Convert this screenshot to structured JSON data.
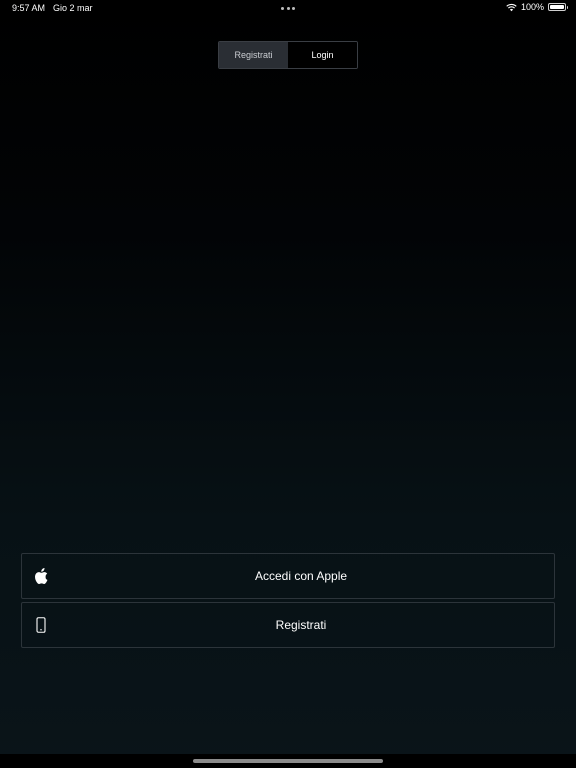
{
  "status_bar": {
    "time": "9:57 AM",
    "date": "Gio 2 mar",
    "battery": "100%",
    "battery_level": 1.0,
    "icons": [
      "wifi-icon",
      "battery-icon"
    ]
  },
  "segmented_control": {
    "selected": "Registrati",
    "segments": [
      {
        "label": "Registrati",
        "active": true
      },
      {
        "label": "Login",
        "active": false
      }
    ]
  },
  "actions": {
    "apple": {
      "label": "Accedi con Apple",
      "icon": "apple-icon"
    },
    "register": {
      "label": "Registrati",
      "icon": "phone-icon"
    }
  },
  "colors": {
    "background_top": "#000000",
    "background_bottom": "#0a1419",
    "button_border": "#2c343a",
    "segment_active": "#2a2e34"
  }
}
